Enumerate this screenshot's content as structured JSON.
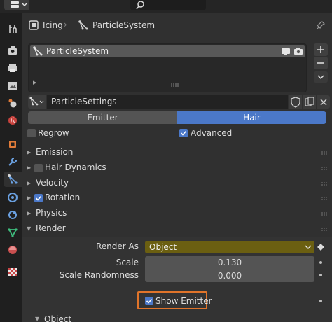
{
  "breadcrumb": {
    "object": "Icing",
    "separator": "›",
    "system": "ParticleSystem"
  },
  "list": {
    "items": [
      {
        "label": "ParticleSystem"
      }
    ]
  },
  "datablock": {
    "name": "ParticleSettings"
  },
  "type_toggle": {
    "options": [
      "Emitter",
      "Hair"
    ],
    "selected": "Hair"
  },
  "options": {
    "regrow": {
      "label": "Regrow",
      "checked": false
    },
    "advanced": {
      "label": "Advanced",
      "checked": true
    }
  },
  "panels": {
    "emission": "Emission",
    "hair_dynamics": "Hair Dynamics",
    "velocity": "Velocity",
    "rotation": "Rotation",
    "physics": "Physics",
    "render": "Render",
    "object": "Object"
  },
  "render": {
    "render_as_label": "Render As",
    "render_as_value": "Object",
    "scale_label": "Scale",
    "scale_value": "0.130",
    "scale_randomness_label": "Scale Randomness",
    "scale_randomness_value": "0.000",
    "show_emitter_label": "Show Emitter"
  },
  "colors": {
    "accent": "#4b78c8",
    "enum_highlight": "#6b5f11",
    "focus_outline": "#e0742a"
  }
}
